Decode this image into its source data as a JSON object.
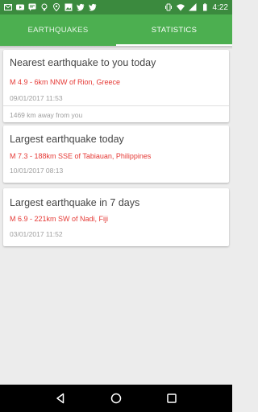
{
  "status_bar": {
    "time": "4:22",
    "left_icons": [
      "mail-icon",
      "youtube-icon",
      "message-icon",
      "bulb-icon",
      "location-icon",
      "image-icon",
      "twitter-icon",
      "twitter-icon"
    ],
    "right_icons": [
      "vibrate-icon",
      "wifi-icon",
      "signal-icon",
      "battery-icon"
    ]
  },
  "tabs": [
    {
      "label": "EARTHQUAKES",
      "active": false
    },
    {
      "label": "STATISTICS",
      "active": true
    }
  ],
  "cards": [
    {
      "title": "Nearest earthquake to you today",
      "quake": "M 4.9 - 6km NNW of Rion, Greece",
      "date": "09/01/2017 11:53",
      "distance": "1469 km away from you"
    },
    {
      "title": "Largest earthquake today",
      "quake": "M 7.3 - 188km SSE of Tabiauan, Philippines",
      "date": "10/01/2017 08:13"
    },
    {
      "title": "Largest earthquake in 7 days",
      "quake": "M 6.9 - 221km SW of Nadi, Fiji",
      "date": "03/01/2017 11:52"
    }
  ],
  "colors": {
    "status_bar": "#3b8a3e",
    "tab_bar": "#4caf50",
    "quake_text": "#e53935",
    "background": "#ececec"
  },
  "nav_bar": [
    "back-icon",
    "home-icon",
    "recents-icon"
  ]
}
